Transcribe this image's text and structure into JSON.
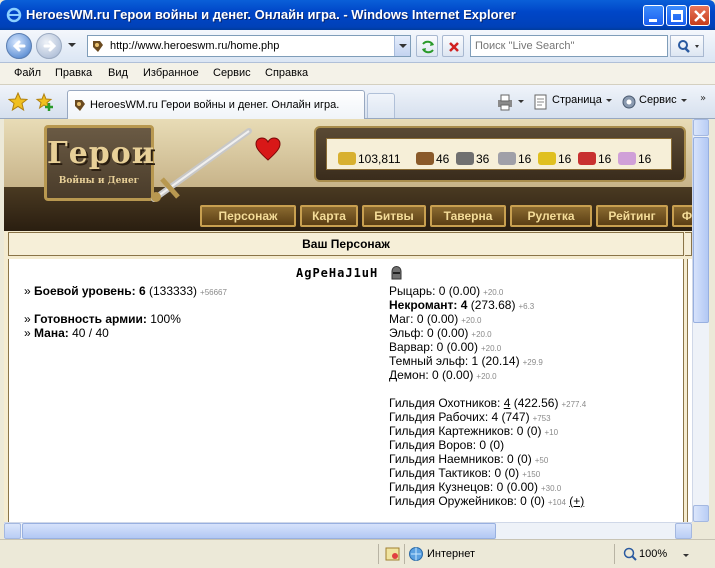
{
  "window": {
    "title": "HeroesWM.ru Герои войны и денег. Онлайн игра. - Windows Internet Explorer"
  },
  "address": {
    "url": "http://www.heroeswm.ru/home.php"
  },
  "search": {
    "placeholder": "Поиск \"Live Search\""
  },
  "menu": [
    "Файл",
    "Правка",
    "Вид",
    "Избранное",
    "Сервис",
    "Справка"
  ],
  "tab": {
    "label": "HeroesWM.ru Герои войны и денег. Онлайн игра."
  },
  "commands": {
    "page": "Страница",
    "tools": "Сервис"
  },
  "status": {
    "zone": "Интернет",
    "zoom": "100%"
  },
  "game": {
    "logo_big": "Герои",
    "logo_small": "Войны и Денег",
    "resources": [
      {
        "icon": "gold-icon",
        "value": "103,811",
        "color": "#d8b030"
      },
      {
        "icon": "wood-icon",
        "value": "46",
        "color": "#8a5a2a"
      },
      {
        "icon": "ore-icon",
        "value": "36",
        "color": "#707070"
      },
      {
        "icon": "mercury-icon",
        "value": "16",
        "color": "#a0a0a8"
      },
      {
        "icon": "sulfur-icon",
        "value": "16",
        "color": "#e0c020"
      },
      {
        "icon": "crystal-icon",
        "value": "16",
        "color": "#c83030"
      },
      {
        "icon": "gems-icon",
        "value": "16",
        "color": "#d0a0d8"
      }
    ],
    "nav": [
      "Персонаж",
      "Карта",
      "Битвы",
      "Таверна",
      "Рулетка",
      "Рейтинг",
      "Ф"
    ],
    "section_title": "Ваш Персонаж",
    "character_name": "AgPeHaJ1uH",
    "left": {
      "combat_label": "Боевой уровень:",
      "combat_level": "6",
      "combat_exp": "(133333)",
      "combat_sub": "+56667",
      "army_label": "Готовность армии:",
      "army_value": "100%",
      "mana_label": "Мана:",
      "mana_value": "40 / 40"
    },
    "factions": [
      {
        "name": "Рыцарь:",
        "value": "0 (0.00)",
        "sub": "+20.0",
        "bold": false
      },
      {
        "name": "Некромант:",
        "value": "4",
        "value2": "(273.68)",
        "sub": "+6.3",
        "bold": true
      },
      {
        "name": "Маг:",
        "value": "0 (0.00)",
        "sub": "+20.0",
        "bold": false
      },
      {
        "name": "Эльф:",
        "value": "0 (0.00)",
        "sub": "+20.0",
        "bold": false
      },
      {
        "name": "Варвар:",
        "value": "0 (0.00)",
        "sub": "+20.0",
        "bold": false
      },
      {
        "name": "Темный эльф:",
        "value": "1 (20.14)",
        "sub": "+29.9",
        "bold": false
      },
      {
        "name": "Демон:",
        "value": "0 (0.00)",
        "sub": "+20.0",
        "bold": false
      }
    ],
    "guilds": [
      {
        "name": "Гильдия Охотников:",
        "level": "4",
        "value": "(422.56)",
        "sub": "+277.4"
      },
      {
        "name": "Гильдия Рабочих:",
        "level": "4",
        "value": "(747)",
        "sub": "+753"
      },
      {
        "name": "Гильдия Картежников:",
        "level": "0",
        "value": "(0)",
        "sub": "+10"
      },
      {
        "name": "Гильдия Воров:",
        "level": "0",
        "value": "(0)",
        "sub": ""
      },
      {
        "name": "Гильдия Наемников:",
        "level": "0",
        "value": "(0)",
        "sub": "+50"
      },
      {
        "name": "Гильдия Тактиков:",
        "level": "0",
        "value": "(0)",
        "sub": "+150"
      },
      {
        "name": "Гильдия Кузнецов:",
        "level": "0",
        "value": "(0.00)",
        "sub": "+30.0"
      },
      {
        "name": "Гильдия Оружейников:",
        "level": "0",
        "value": "(0)",
        "sub": "+104",
        "extra": "(+)"
      }
    ]
  }
}
